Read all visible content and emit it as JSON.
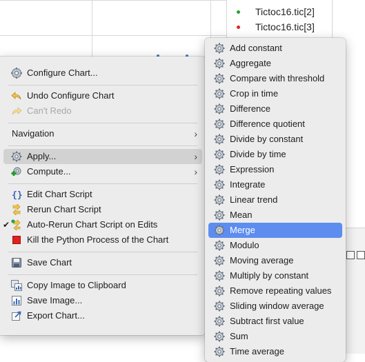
{
  "legend": {
    "items": [
      {
        "label": "Tictoc16.tic[2]",
        "color": "#2ca02c"
      },
      {
        "label": "Tictoc16.tic[3]",
        "color": "#d62728"
      }
    ]
  },
  "context_menu": {
    "items": [
      {
        "label": "Configure Chart...",
        "icon": "configure-icon"
      },
      {
        "label": "Undo Configure Chart",
        "icon": "undo-icon"
      },
      {
        "label": "Can't Redo",
        "icon": "redo-icon",
        "disabled": true
      },
      {
        "label": "Navigation",
        "has_submenu": true
      },
      {
        "label": "Apply...",
        "icon": "gear-icon",
        "has_submenu": true,
        "highlighted": true
      },
      {
        "label": "Compute...",
        "icon": "compute-icon",
        "has_submenu": true
      },
      {
        "label": "Edit Chart Script",
        "icon": "script-icon"
      },
      {
        "label": "Rerun Chart Script",
        "icon": "rerun-icon"
      },
      {
        "label": "Auto-Rerun Chart Script on Edits",
        "icon": "auto-rerun-icon",
        "checked": true
      },
      {
        "label": "Kill the Python Process of the Chart",
        "icon": "stop-icon"
      },
      {
        "label": "Save Chart",
        "icon": "save-icon"
      },
      {
        "label": "Copy Image to Clipboard",
        "icon": "copy-image-icon"
      },
      {
        "label": "Save Image...",
        "icon": "image-icon"
      },
      {
        "label": "Export Chart...",
        "icon": "export-icon"
      }
    ]
  },
  "apply_submenu": {
    "items": [
      {
        "label": "Add constant"
      },
      {
        "label": "Aggregate"
      },
      {
        "label": "Compare with threshold"
      },
      {
        "label": "Crop in time"
      },
      {
        "label": "Difference"
      },
      {
        "label": "Difference quotient"
      },
      {
        "label": "Divide by constant"
      },
      {
        "label": "Divide by time"
      },
      {
        "label": "Expression"
      },
      {
        "label": "Integrate"
      },
      {
        "label": "Linear trend"
      },
      {
        "label": "Mean"
      },
      {
        "label": "Merge",
        "selected": true
      },
      {
        "label": "Modulo"
      },
      {
        "label": "Moving average"
      },
      {
        "label": "Multiply by constant"
      },
      {
        "label": "Remove repeating values"
      },
      {
        "label": "Sliding window average"
      },
      {
        "label": "Subtract first value"
      },
      {
        "label": "Sum"
      },
      {
        "label": "Time average"
      }
    ]
  }
}
